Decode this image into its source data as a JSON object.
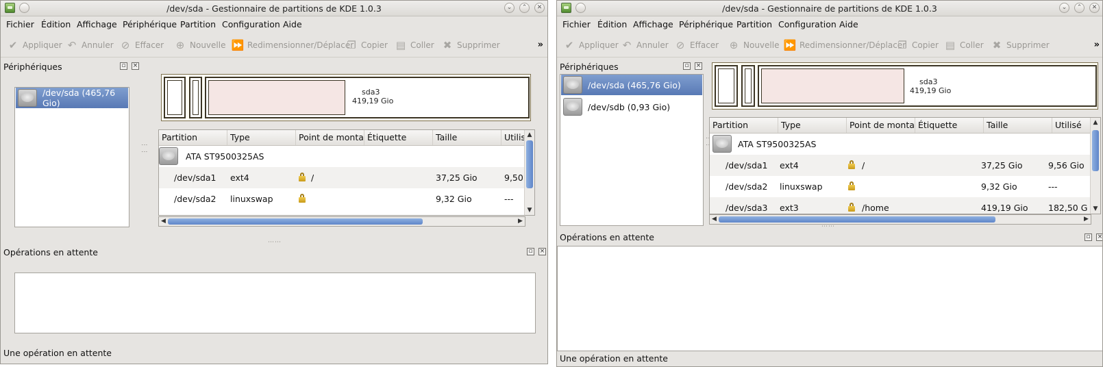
{
  "windows": [
    {
      "title": "/dev/sda - Gestionnaire de partitions de KDE 1.0.3",
      "menu": [
        "Fichier",
        "Édition",
        "Affichage",
        "Périphérique",
        "Partition",
        "Configuration",
        "Aide"
      ],
      "toolbar": [
        "Appliquer",
        "Annuler",
        "Effacer",
        "Nouvelle",
        "Redimensionner/Déplacer",
        "Copier",
        "Coller",
        "Supprimer"
      ],
      "toolbar_more": "»",
      "devices_title": "Périphériques",
      "devices": [
        "/dev/sda (465,76 Gio)"
      ],
      "partition_bar": {
        "label_name": "sda3",
        "label_size": "419,19 Gio"
      },
      "columns": [
        "Partition",
        "Type",
        "Point de montag",
        "Étiquette",
        "Taille",
        "Utilis"
      ],
      "disk_row": "ATA ST9500325AS",
      "rows": [
        {
          "partition": "/dev/sda1",
          "type": "ext4",
          "mount": "/",
          "label": "",
          "size": "37,25 Gio",
          "used": "9,50"
        },
        {
          "partition": "/dev/sda2",
          "type": "linuxswap",
          "mount": "",
          "label": "",
          "size": "9,32 Gio",
          "used": "---"
        }
      ],
      "pending_title": "Opérations en attente",
      "status": "Une opération en attente"
    },
    {
      "title": "/dev/sda - Gestionnaire de partitions de KDE 1.0.3",
      "menu": [
        "Fichier",
        "Édition",
        "Affichage",
        "Périphérique",
        "Partition",
        "Configuration",
        "Aide"
      ],
      "toolbar": [
        "Appliquer",
        "Annuler",
        "Effacer",
        "Nouvelle",
        "Redimensionner/Déplacer",
        "Copier",
        "Coller",
        "Supprimer"
      ],
      "toolbar_more": "»",
      "devices_title": "Périphériques",
      "devices": [
        "/dev/sda (465,76 Gio)",
        "/dev/sdb (0,93 Gio)"
      ],
      "partition_bar": {
        "label_name": "sda3",
        "label_size": "419,19 Gio"
      },
      "columns": [
        "Partition",
        "Type",
        "Point de montag",
        "Étiquette",
        "Taille",
        "Utilisé"
      ],
      "disk_row": "ATA ST9500325AS",
      "rows": [
        {
          "partition": "/dev/sda1",
          "type": "ext4",
          "mount": "/",
          "label": "",
          "size": "37,25 Gio",
          "used": "9,56 Gio"
        },
        {
          "partition": "/dev/sda2",
          "type": "linuxswap",
          "mount": "",
          "label": "",
          "size": "9,32 Gio",
          "used": "---"
        },
        {
          "partition": "/dev/sda3",
          "type": "ext3",
          "mount": "/home",
          "label": "",
          "size": "419,19 Gio",
          "used": "182,50 G"
        }
      ],
      "pending_title": "Opérations en attente",
      "status": "Une opération en attente"
    }
  ],
  "icons": {
    "apply": "check-icon",
    "undo": "undo-icon",
    "clear": "clear-icon",
    "new": "new-partition-icon",
    "resize": "resize-icon",
    "copy": "copy-icon",
    "paste": "paste-icon",
    "delete": "delete-icon",
    "lock": "lock-icon",
    "disk": "disk-icon"
  },
  "colors": {
    "selection": "#5f80b9",
    "partition_fill": "#f5e6e4",
    "partition_border": "#3b3424"
  }
}
